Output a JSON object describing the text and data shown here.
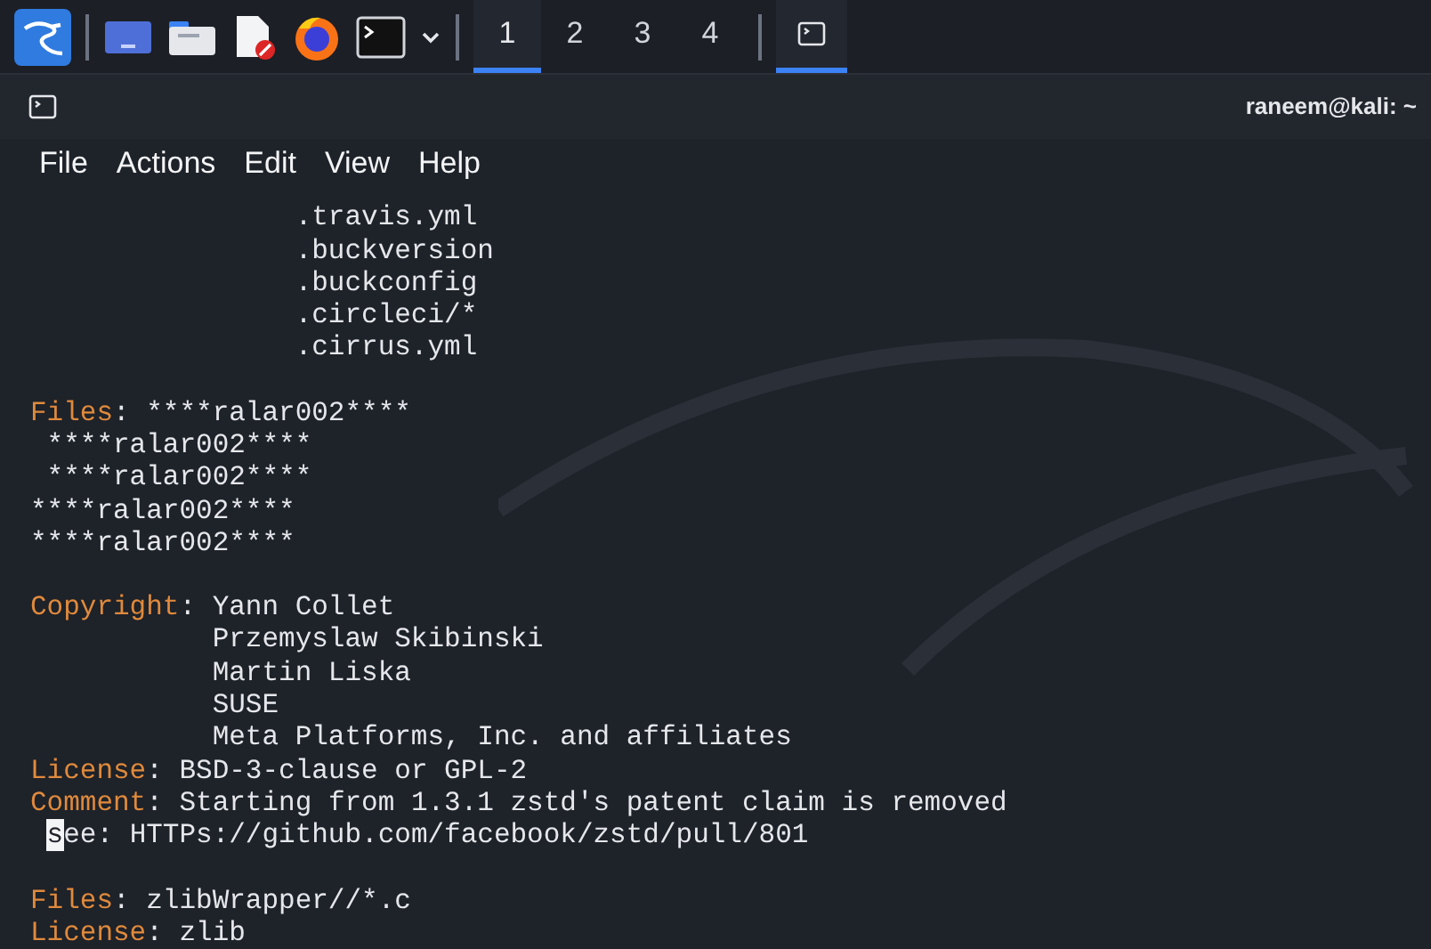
{
  "taskbar": {
    "workspaces": [
      {
        "label": "1",
        "selected": true
      },
      {
        "label": "2",
        "selected": false
      },
      {
        "label": "3",
        "selected": false
      },
      {
        "label": "4",
        "selected": false
      }
    ],
    "tasks": [
      {
        "selected": true
      }
    ]
  },
  "window": {
    "title": "raneem@kali: ~"
  },
  "menu": [
    "File",
    "Actions",
    "Edit",
    "View",
    "Help"
  ],
  "terminal": {
    "paragraphs": [
      [
        [
          {
            "kind": "text",
            "text": "                .travis.yml"
          }
        ],
        [
          {
            "kind": "text",
            "text": "                .buckversion"
          }
        ],
        [
          {
            "kind": "text",
            "text": "                .buckconfig"
          }
        ],
        [
          {
            "kind": "text",
            "text": "                .circleci/*"
          }
        ],
        [
          {
            "kind": "text",
            "text": "                .cirrus.yml"
          }
        ]
      ],
      [
        [
          {
            "kind": "key",
            "text": "Files"
          },
          {
            "kind": "text",
            "text": ": ****ralar002****"
          }
        ],
        [
          {
            "kind": "text",
            "text": " ****ralar002****"
          }
        ],
        [
          {
            "kind": "text",
            "text": " ****ralar002****"
          }
        ],
        [
          {
            "kind": "text",
            "text": "****ralar002****"
          }
        ],
        [
          {
            "kind": "text",
            "text": "****ralar002****"
          }
        ]
      ],
      [
        [
          {
            "kind": "key",
            "text": "Copyright"
          },
          {
            "kind": "text",
            "text": ": Yann Collet"
          }
        ],
        [
          {
            "kind": "text",
            "text": "           Przemyslaw Skibinski"
          }
        ],
        [
          {
            "kind": "text",
            "text": "           Martin Liska"
          }
        ],
        [
          {
            "kind": "text",
            "text": "           SUSE"
          }
        ],
        [
          {
            "kind": "text",
            "text": "           Meta Platforms, Inc. and affiliates"
          }
        ],
        [
          {
            "kind": "key",
            "text": "License"
          },
          {
            "kind": "text",
            "text": ": BSD-3-clause or GPL-2"
          }
        ],
        [
          {
            "kind": "key",
            "text": "Comment"
          },
          {
            "kind": "text",
            "text": ": Starting from 1.3.1 zstd's patent claim is removed"
          }
        ],
        [
          {
            "kind": "cursor",
            "text": "s"
          },
          {
            "kind": "text",
            "text": "ee: HTTPs://github.com/facebook/zstd/pull/801"
          }
        ]
      ],
      [
        [
          {
            "kind": "key",
            "text": "Files"
          },
          {
            "kind": "text",
            "text": ": zlibWrapper//*.c"
          }
        ],
        [
          {
            "kind": "key",
            "text": "License"
          },
          {
            "kind": "text",
            "text": ": zlib"
          }
        ]
      ]
    ]
  }
}
